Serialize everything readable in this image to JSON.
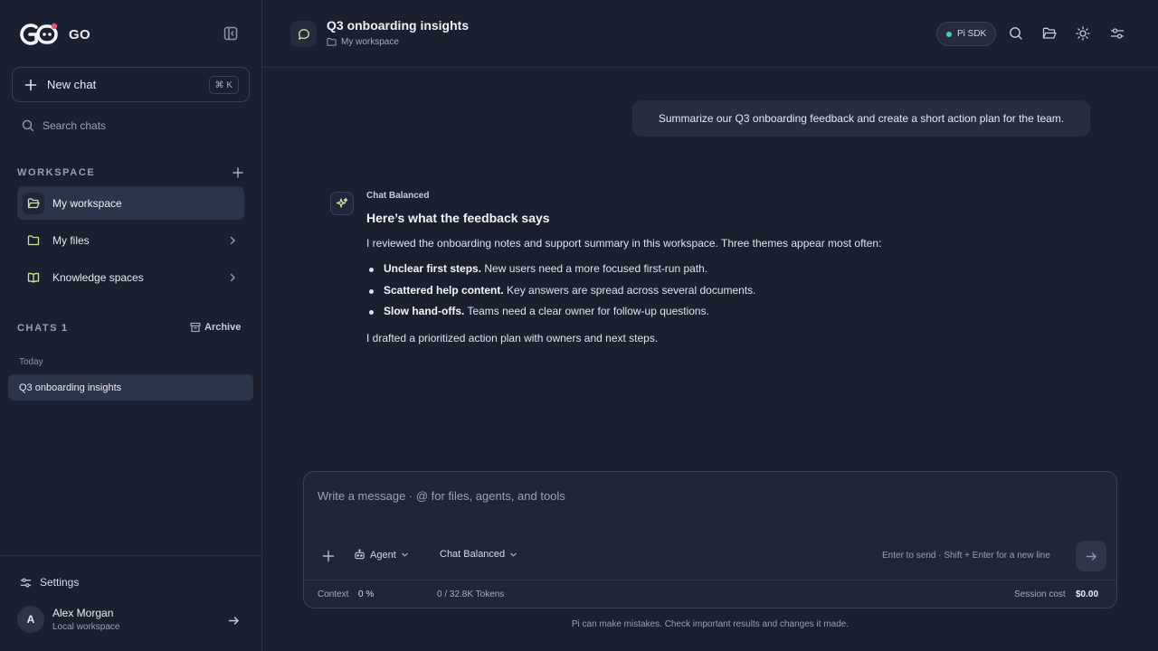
{
  "app": {
    "name": "GO"
  },
  "sidebar": {
    "new_chat_label": "New chat",
    "new_chat_shortcut": "⌘ K",
    "search_placeholder": "Search chats",
    "workspace_label": "WORKSPACE",
    "nav_items": [
      {
        "label": "My workspace",
        "icon": "folder-open-icon",
        "active": true
      },
      {
        "label": "My files",
        "icon": "folder-icon",
        "active": false
      },
      {
        "label": "Knowledge spaces",
        "icon": "book-open-icon",
        "active": false
      }
    ],
    "chats_label": "CHATS",
    "chats_count": "1",
    "archive_label": "Archive",
    "group_today": "Today",
    "chats": [
      {
        "title": "Q3 onboarding insights",
        "active": true
      }
    ],
    "settings_label": "Settings",
    "user": {
      "initial": "A",
      "name": "Alex Morgan",
      "subtitle": "Local workspace"
    }
  },
  "header": {
    "title": "Q3 onboarding insights",
    "breadcrumb": "My workspace",
    "sdk_badge": "Pi SDK",
    "status_color": "#58c9a0",
    "accent_color": "#cfe39a"
  },
  "conversation": {
    "user_message": "Summarize our Q3 onboarding feedback and create a short action plan for the team.",
    "assistant": {
      "model": "Chat Balanced",
      "heading": "Here’s what the feedback says",
      "intro": "I reviewed the onboarding notes and support summary in this workspace. Three themes appear most often:",
      "bullets": [
        {
          "bold": "Unclear first steps.",
          "text": " New users need a more focused first-run path."
        },
        {
          "bold": "Scattered help content.",
          "text": " Key answers are spread across several documents."
        },
        {
          "bold": "Slow hand-offs.",
          "text": " Teams need a clear owner for follow-up questions."
        }
      ],
      "outro": "I drafted a prioritized action plan with owners and next steps."
    }
  },
  "composer": {
    "placeholder": "Write a message · @ for files, agents, and tools",
    "mode_label": "Agent",
    "model_label": "Chat Balanced",
    "hint": "Enter to send · Shift + Enter for a new line",
    "context_label": "Context",
    "context_value": "0 %",
    "tokens": "0 / 32.8K Tokens",
    "session_cost_label": "Session cost",
    "session_cost_value": "$0.00"
  },
  "disclaimer": "Pi can make mistakes. Check important results and changes it made."
}
